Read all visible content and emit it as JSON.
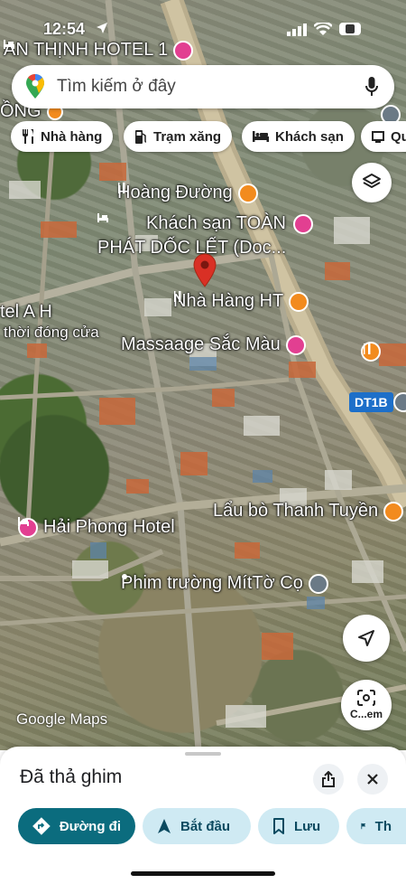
{
  "status_bar": {
    "time": "12:54"
  },
  "search": {
    "placeholder": "Tìm kiếm ở đây"
  },
  "chips": [
    {
      "label": "Nhà hàng",
      "icon": "fork-knife-icon"
    },
    {
      "label": "Trạm xăng",
      "icon": "gas-station-icon"
    },
    {
      "label": "Khách sạn",
      "icon": "bed-icon"
    },
    {
      "label": "Qu",
      "icon": "shopping-icon"
    }
  ],
  "map": {
    "labels": {
      "hotel_top": "AN THỊNH HOTEL 1",
      "left_fragment": "ỒNG",
      "hoang_duong": "Hoàng Đường",
      "toan_phat_line1": "Khách sạn TOÀN",
      "toan_phat_line2": "PHÁT DỐC LẾT (Doc...",
      "nha_hang_ht": "Nhà Hàng HT",
      "tel_ah": "tel A H",
      "closed": "thời đóng cửa",
      "massage": "Massaage Sắc Màu",
      "road_dt1b": "DT1B",
      "lau_bo": "Lẩu bò Thanh Tuyền",
      "hai_phong": "Hải Phong Hotel",
      "phim_truong": "Phim trường MítTờ Cọ"
    },
    "attribution": "Google Maps",
    "camera_label": "C...em"
  },
  "sheet": {
    "title": "Đã thả ghim",
    "actions": [
      {
        "label": "Đường đi",
        "icon": "directions-icon"
      },
      {
        "label": "Bắt đầu",
        "icon": "navigation-icon"
      },
      {
        "label": "Lưu",
        "icon": "bookmark-icon"
      },
      {
        "label": "Th",
        "icon": "flag-icon"
      }
    ]
  },
  "colors": {
    "hotel_pin": "#e23f91",
    "food_pin": "#f28b1e",
    "dropped_pin": "#d93025",
    "primary_action": "#0b6c7e",
    "secondary_action": "#cfeaf3"
  }
}
